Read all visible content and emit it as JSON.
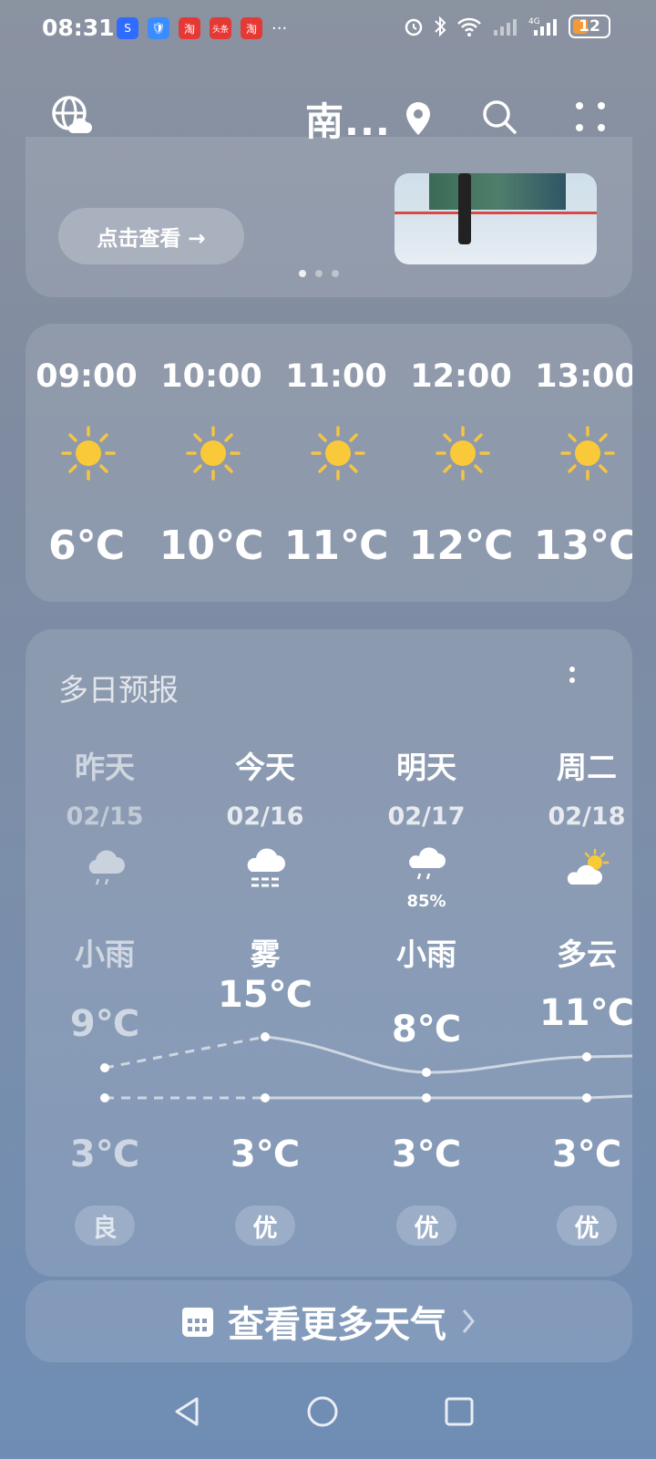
{
  "status_bar": {
    "time": "08:31",
    "battery": "12",
    "app_badges": [
      "S",
      "🛡",
      "淘",
      "头条",
      "淘"
    ],
    "more": "···",
    "network": "4G"
  },
  "header": {
    "city": "南..."
  },
  "video_card": {
    "button_label": "点击查看 →"
  },
  "hourly": [
    {
      "time": "09:00",
      "temp": "6℃",
      "icon": "sun-icon"
    },
    {
      "time": "10:00",
      "temp": "10℃",
      "icon": "sun-icon"
    },
    {
      "time": "11:00",
      "temp": "11℃",
      "icon": "sun-icon"
    },
    {
      "time": "12:00",
      "temp": "12℃",
      "icon": "sun-icon"
    },
    {
      "time": "13:00",
      "temp": "13℃",
      "icon": "sun-icon"
    }
  ],
  "daily": {
    "title": "多日预报",
    "days": [
      {
        "name": "昨天",
        "date": "02/15",
        "cond": "小雨",
        "high": "9℃",
        "low": "3℃",
        "aqi": "良",
        "pct": "",
        "icon": "rain-cloud-icon"
      },
      {
        "name": "今天",
        "date": "02/16",
        "cond": "雾",
        "high": "15℃",
        "low": "3℃",
        "aqi": "优",
        "pct": "",
        "icon": "fog-icon"
      },
      {
        "name": "明天",
        "date": "02/17",
        "cond": "小雨",
        "high": "8℃",
        "low": "3℃",
        "aqi": "优",
        "pct": "85%",
        "icon": "rain-cloud-icon"
      },
      {
        "name": "周二",
        "date": "02/18",
        "cond": "多云",
        "high": "11℃",
        "low": "3℃",
        "aqi": "优",
        "pct": "",
        "icon": "partly-cloudy-icon"
      }
    ]
  },
  "more_weather": {
    "label": "查看更多天气"
  }
}
